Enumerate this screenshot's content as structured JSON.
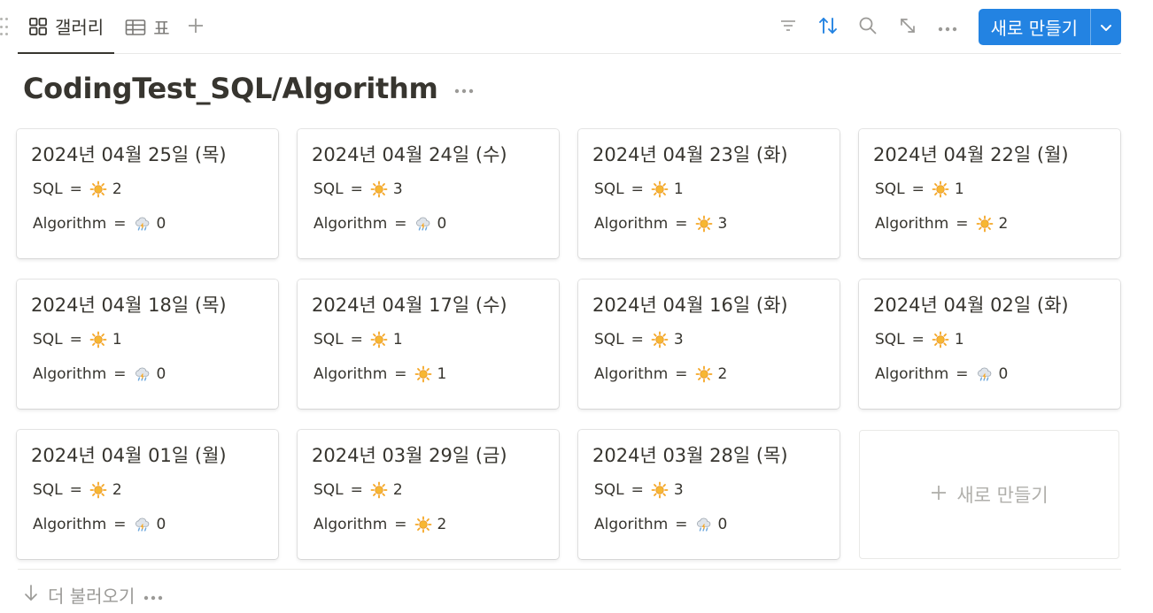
{
  "views": {
    "gallery_label": "갤러리",
    "table_label": "표",
    "gallery_icon": "gallery-grid-icon",
    "table_icon": "table-icon",
    "add_icon": "plus-icon"
  },
  "toolbar": {
    "filter_icon": "filter-icon",
    "sort_icon": "sort-icon",
    "search_icon": "search-icon",
    "expand_icon": "expand-icon",
    "more_icon": "more-icon",
    "new_label": "새로 만들기",
    "accent": "#2383e2"
  },
  "page": {
    "title": "CodingTest_SQL/Algorithm"
  },
  "prop_names": {
    "sql": "SQL",
    "algorithm": "Algorithm",
    "equals": "="
  },
  "cards": [
    {
      "title": "2024년 04월 25일 (목)",
      "sql": {
        "icon": "sun",
        "value": "2"
      },
      "algorithm": {
        "icon": "cloud-rain",
        "value": "0"
      }
    },
    {
      "title": "2024년 04월 24일 (수)",
      "sql": {
        "icon": "sun",
        "value": "3"
      },
      "algorithm": {
        "icon": "cloud-rain",
        "value": "0"
      }
    },
    {
      "title": "2024년 04월 23일 (화)",
      "sql": {
        "icon": "sun",
        "value": "1"
      },
      "algorithm": {
        "icon": "sun",
        "value": "3"
      }
    },
    {
      "title": "2024년 04월 22일 (월)",
      "sql": {
        "icon": "sun",
        "value": "1"
      },
      "algorithm": {
        "icon": "sun",
        "value": "2"
      }
    },
    {
      "title": "2024년 04월 18일 (목)",
      "sql": {
        "icon": "sun",
        "value": "1"
      },
      "algorithm": {
        "icon": "cloud-rain",
        "value": "0"
      }
    },
    {
      "title": "2024년 04월 17일 (수)",
      "sql": {
        "icon": "sun",
        "value": "1"
      },
      "algorithm": {
        "icon": "sun",
        "value": "1"
      }
    },
    {
      "title": "2024년 04월 16일 (화)",
      "sql": {
        "icon": "sun",
        "value": "3"
      },
      "algorithm": {
        "icon": "sun",
        "value": "2"
      }
    },
    {
      "title": "2024년 04월 02일 (화)",
      "sql": {
        "icon": "sun",
        "value": "1"
      },
      "algorithm": {
        "icon": "cloud-rain",
        "value": "0"
      }
    },
    {
      "title": "2024년 04월 01일 (월)",
      "sql": {
        "icon": "sun",
        "value": "2"
      },
      "algorithm": {
        "icon": "cloud-rain",
        "value": "0"
      }
    },
    {
      "title": "2024년 03월 29일 (금)",
      "sql": {
        "icon": "sun",
        "value": "2"
      },
      "algorithm": {
        "icon": "sun",
        "value": "2"
      }
    },
    {
      "title": "2024년 03월 28일 (목)",
      "sql": {
        "icon": "sun",
        "value": "3"
      },
      "algorithm": {
        "icon": "cloud-rain",
        "value": "0"
      }
    }
  ],
  "new_card": {
    "label": "새로 만들기",
    "icon": "plus-icon"
  },
  "footer": {
    "load_more_label": "더 불러오기",
    "arrow_icon": "arrow-down-icon",
    "more_icon": "more-icon"
  },
  "colors": {
    "sun": "#f5a623",
    "text": "#37352f",
    "muted": "#9b9a97"
  }
}
